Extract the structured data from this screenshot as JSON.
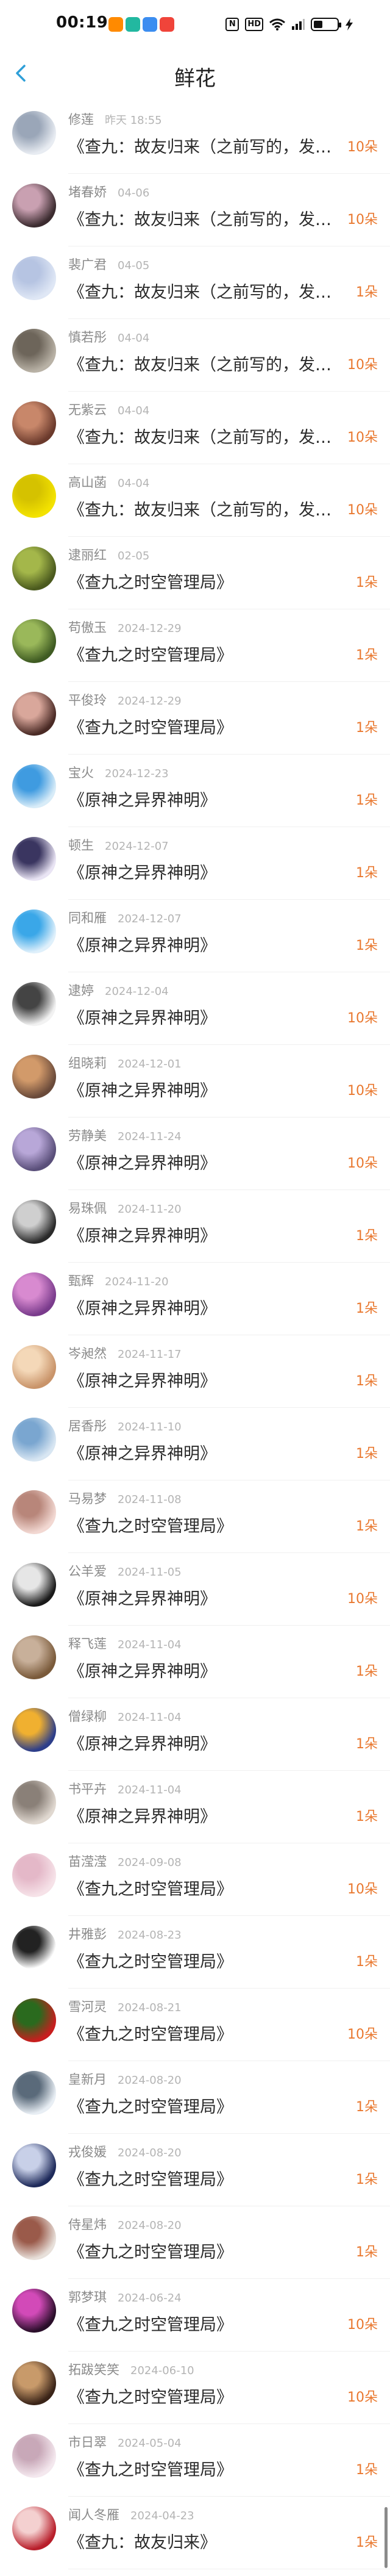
{
  "status_bar": {
    "time": "00:19"
  },
  "nav": {
    "title": "鲜花"
  },
  "gifts": [
    {
      "name": "修莲",
      "time": "昨天 18:55",
      "work": "《查九：故友归来（之前写的，发现能下架，想",
      "count": "10朵",
      "avatar_colors": [
        "#e8ecf2",
        "#9aa6b8"
      ]
    },
    {
      "name": "堵春娇",
      "time": "04-06",
      "work": "《查九：故友归来（之前写的，发现能下架，想",
      "count": "10朵",
      "avatar_colors": [
        "#3b2b2f",
        "#c9a0b1"
      ]
    },
    {
      "name": "裴广君",
      "time": "04-05",
      "work": "《查九：故友归来（之前写的，发现能下架，想",
      "count": "1朵",
      "avatar_colors": [
        "#dfe7f5",
        "#b6c4e2"
      ]
    },
    {
      "name": "慎若彤",
      "time": "04-04",
      "work": "《查九：故友归来（之前写的，发现能下架，想",
      "count": "10朵",
      "avatar_colors": [
        "#b9b2a6",
        "#6d655a"
      ]
    },
    {
      "name": "无紫云",
      "time": "04-04",
      "work": "《查九：故友归来（之前写的，发现能下架，想",
      "count": "10朵",
      "avatar_colors": [
        "#6b3a2c",
        "#c8876a"
      ]
    },
    {
      "name": "高山菡",
      "time": "04-04",
      "work": "《查九：故友归来（之前写的，发现能下架，想",
      "count": "10朵",
      "avatar_colors": [
        "#f3e200",
        "#d5c200"
      ]
    },
    {
      "name": "逮丽红",
      "time": "02-05",
      "work": "《查九之时空管理局》",
      "count": "1朵",
      "avatar_colors": [
        "#4b5a1e",
        "#a4b74a"
      ]
    },
    {
      "name": "苟傲玉",
      "time": "2024-12-29",
      "work": "《查九之时空管理局》",
      "count": "1朵",
      "avatar_colors": [
        "#3f5b22",
        "#9ab85a"
      ]
    },
    {
      "name": "平俊玲",
      "time": "2024-12-29",
      "work": "《查九之时空管理局》",
      "count": "1朵",
      "avatar_colors": [
        "#4a2a25",
        "#d9a79b"
      ]
    },
    {
      "name": "宝火",
      "time": "2024-12-23",
      "work": "《原神之异界神明》",
      "count": "1朵",
      "avatar_colors": [
        "#d8ecf8",
        "#3f9be0"
      ]
    },
    {
      "name": "顿生",
      "time": "2024-12-07",
      "work": "《原神之异界神明》",
      "count": "1朵",
      "avatar_colors": [
        "#e9e4f4",
        "#3a3560"
      ]
    },
    {
      "name": "同和雁",
      "time": "2024-12-07",
      "work": "《原神之异界神明》",
      "count": "1朵",
      "avatar_colors": [
        "#dff0fb",
        "#3aa7e8"
      ]
    },
    {
      "name": "逮婷",
      "time": "2024-12-04",
      "work": "《原神之异界神明》",
      "count": "10朵",
      "avatar_colors": [
        "#f2f2f2",
        "#444444"
      ]
    },
    {
      "name": "组晓莉",
      "time": "2024-12-01",
      "work": "《原神之异界神明》",
      "count": "10朵",
      "avatar_colors": [
        "#6a4a3a",
        "#d29a6a"
      ]
    },
    {
      "name": "劳静美",
      "time": "2024-11-24",
      "work": "《原神之异界神明》",
      "count": "10朵",
      "avatar_colors": [
        "#5a4f7a",
        "#b8a7d8"
      ]
    },
    {
      "name": "易珠佩",
      "time": "2024-11-20",
      "work": "《原神之异界神明》",
      "count": "1朵",
      "avatar_colors": [
        "#2a2a2a",
        "#cfcfcf"
      ]
    },
    {
      "name": "甄辉",
      "time": "2024-11-20",
      "work": "《原神之异界神明》",
      "count": "1朵",
      "avatar_colors": [
        "#7a3b8c",
        "#d88ad0"
      ]
    },
    {
      "name": "岑昶然",
      "time": "2024-11-17",
      "work": "《原神之异界神明》",
      "count": "1朵",
      "avatar_colors": [
        "#c9946a",
        "#f4d8b8"
      ]
    },
    {
      "name": "居香彤",
      "time": "2024-11-10",
      "work": "《原神之异界神明》",
      "count": "1朵",
      "avatar_colors": [
        "#d8e6f2",
        "#7aa6d0"
      ]
    },
    {
      "name": "马易梦",
      "time": "2024-11-08",
      "work": "《查九之时空管理局》",
      "count": "1朵",
      "avatar_colors": [
        "#f2d8d2",
        "#b8867a"
      ]
    },
    {
      "name": "公羊爱",
      "time": "2024-11-05",
      "work": "《原神之异界神明》",
      "count": "10朵",
      "avatar_colors": [
        "#1a1a1a",
        "#e6e6e6"
      ]
    },
    {
      "name": "释飞莲",
      "time": "2024-11-04",
      "work": "《原神之异界神明》",
      "count": "1朵",
      "avatar_colors": [
        "#7a5a3a",
        "#c8b09a"
      ]
    },
    {
      "name": "僧绿柳",
      "time": "2024-11-04",
      "work": "《原神之异界神明》",
      "count": "1朵",
      "avatar_colors": [
        "#2d3e8a",
        "#f0b030"
      ]
    },
    {
      "name": "书平卉",
      "time": "2024-11-04",
      "work": "《原神之异界神明》",
      "count": "1朵",
      "avatar_colors": [
        "#e0d8d0",
        "#8a8078"
      ]
    },
    {
      "name": "苗滢滢",
      "time": "2024-09-08",
      "work": "《查九之时空管理局》",
      "count": "10朵",
      "avatar_colors": [
        "#f6e2e8",
        "#e4b8c8"
      ]
    },
    {
      "name": "井雅彭",
      "time": "2024-08-23",
      "work": "《查九之时空管理局》",
      "count": "1朵",
      "avatar_colors": [
        "#ffffff",
        "#222222"
      ]
    },
    {
      "name": "雪河灵",
      "time": "2024-08-21",
      "work": "《查九之时空管理局》",
      "count": "10朵",
      "avatar_colors": [
        "#c81e1e",
        "#2a6a1e"
      ]
    },
    {
      "name": "皇新月",
      "time": "2024-08-20",
      "work": "《查九之时空管理局》",
      "count": "1朵",
      "avatar_colors": [
        "#e8eef4",
        "#5a6a7a"
      ]
    },
    {
      "name": "戎俊媛",
      "time": "2024-08-20",
      "work": "《查九之时空管理局》",
      "count": "1朵",
      "avatar_colors": [
        "#1e2a5a",
        "#c8d0e8"
      ]
    },
    {
      "name": "侍星炜",
      "time": "2024-08-20",
      "work": "《查九之时空管理局》",
      "count": "1朵",
      "avatar_colors": [
        "#e8e0da",
        "#9a5a4a"
      ]
    },
    {
      "name": "郭梦琪",
      "time": "2024-06-24",
      "work": "《查九之时空管理局》",
      "count": "10朵",
      "avatar_colors": [
        "#2a0e2a",
        "#d24ab8"
      ]
    },
    {
      "name": "拓跋笑笑",
      "time": "2024-06-10",
      "work": "《查九之时空管理局》",
      "count": "10朵",
      "avatar_colors": [
        "#3a2418",
        "#c89a6a"
      ]
    },
    {
      "name": "市日翠",
      "time": "2024-05-04",
      "work": "《查九之时空管理局》",
      "count": "1朵",
      "avatar_colors": [
        "#f4e8ee",
        "#c8a8b8"
      ]
    },
    {
      "name": "闻人冬雁",
      "time": "2024-04-23",
      "work": "《查九：故友归来》",
      "count": "1朵",
      "avatar_colors": [
        "#b81e2a",
        "#f4d0d0"
      ]
    }
  ],
  "colors": {
    "accent": "#e9782f",
    "back_arrow": "#2f9fd8"
  }
}
